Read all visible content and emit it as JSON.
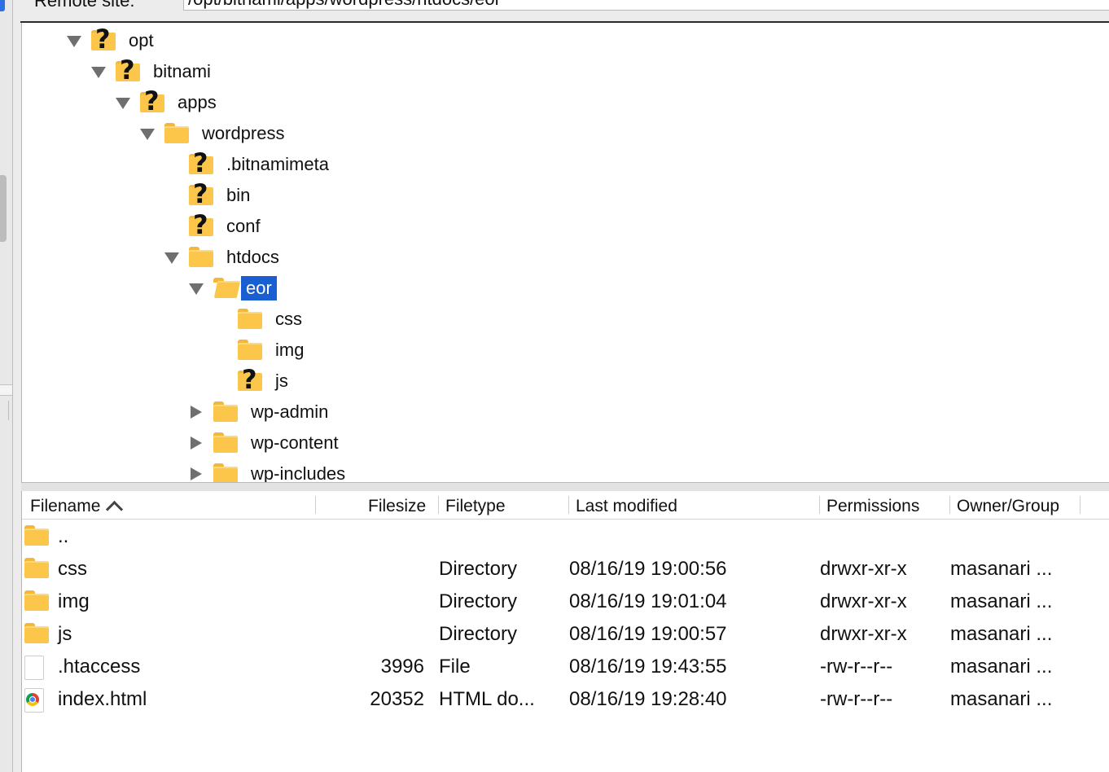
{
  "remote_site": {
    "label": "Remote site:",
    "path": "/opt/bitnami/apps/wordpress/htdocs/eor"
  },
  "tree": [
    {
      "label": "opt",
      "icon": "question-folder-icon",
      "expander": "expanded"
    },
    {
      "label": "bitnami",
      "icon": "question-folder-icon",
      "expander": "expanded"
    },
    {
      "label": "apps",
      "icon": "question-folder-icon",
      "expander": "expanded"
    },
    {
      "label": "wordpress",
      "icon": "folder-icon",
      "expander": "expanded"
    },
    {
      "label": ".bitnamimeta",
      "icon": "question-folder-icon",
      "expander": "none"
    },
    {
      "label": "bin",
      "icon": "question-folder-icon",
      "expander": "none"
    },
    {
      "label": "conf",
      "icon": "question-folder-icon",
      "expander": "none"
    },
    {
      "label": "htdocs",
      "icon": "folder-icon",
      "expander": "expanded"
    },
    {
      "label": "eor",
      "icon": "open-folder-icon",
      "expander": "expanded",
      "selected": true
    },
    {
      "label": "css",
      "icon": "folder-icon",
      "expander": "none"
    },
    {
      "label": "img",
      "icon": "folder-icon",
      "expander": "none"
    },
    {
      "label": "js",
      "icon": "question-folder-icon",
      "expander": "none"
    },
    {
      "label": "wp-admin",
      "icon": "folder-icon",
      "expander": "collapsed"
    },
    {
      "label": "wp-content",
      "icon": "folder-icon",
      "expander": "collapsed"
    },
    {
      "label": "wp-includes",
      "icon": "folder-icon",
      "expander": "collapsed"
    }
  ],
  "list": {
    "columns": {
      "filename": "Filename",
      "filesize": "Filesize",
      "filetype": "Filetype",
      "last_modified": "Last modified",
      "permissions": "Permissions",
      "owner_group": "Owner/Group"
    },
    "sort": {
      "column": "Filename",
      "direction": "ascending",
      "icon": "chevron-up-icon"
    },
    "rows": [
      {
        "name": "..",
        "size": "",
        "type": "",
        "modified": "",
        "perms": "",
        "owner": "",
        "icon": "folder-icon"
      },
      {
        "name": "css",
        "size": "",
        "type": "Directory",
        "modified": "08/16/19 19:00:56",
        "perms": "drwxr-xr-x",
        "owner": "masanari ...",
        "icon": "folder-icon"
      },
      {
        "name": "img",
        "size": "",
        "type": "Directory",
        "modified": "08/16/19 19:01:04",
        "perms": "drwxr-xr-x",
        "owner": "masanari ...",
        "icon": "folder-icon"
      },
      {
        "name": "js",
        "size": "",
        "type": "Directory",
        "modified": "08/16/19 19:00:57",
        "perms": "drwxr-xr-x",
        "owner": "masanari ...",
        "icon": "folder-icon"
      },
      {
        "name": ".htaccess",
        "size": "3996",
        "type": "File",
        "modified": "08/16/19 19:43:55",
        "perms": "-rw-r--r--",
        "owner": "masanari ...",
        "icon": "file-icon"
      },
      {
        "name": "index.html",
        "size": "20352",
        "type": "HTML do...",
        "modified": "08/16/19 19:28:40",
        "perms": "-rw-r--r--",
        "owner": "masanari ...",
        "icon": "html-file-icon"
      }
    ]
  },
  "colors": {
    "selection": "#1a5fd1",
    "folder": "#fcc64a"
  }
}
